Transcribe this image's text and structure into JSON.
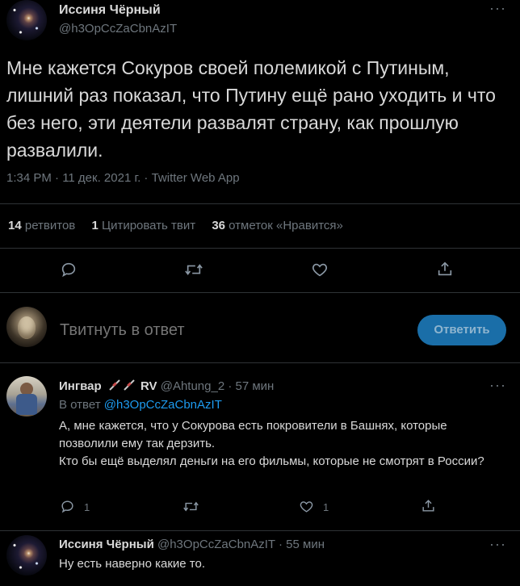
{
  "main_tweet": {
    "author_name": "Иссиня Чёрный",
    "author_handle": "@h3OpCcZaCbnAzIT",
    "text": "Мне кажется Сокуров своей полемикой с Путиным, лишний раз показал, что Путину ещё рано уходить и что без него, эти деятели развалят страну, как прошлую развалили.",
    "timestamp": "1:34 PM · 11 дек. 2021 г. · Twitter Web App",
    "stats": {
      "retweets_count": "14",
      "retweets_label": "ретвитов",
      "quotes_count": "1",
      "quotes_label": "Цитировать твит",
      "likes_count": "36",
      "likes_label": "отметок «Нравится»"
    }
  },
  "reply_box": {
    "placeholder": "Твитнуть в ответ",
    "button_label": "Ответить"
  },
  "replies": [
    {
      "author_name": "Ингвар",
      "author_suffix": "RV",
      "author_emoji": "syringe-icon",
      "author_handle": "@Ahtung_2",
      "time": "· 57 мин",
      "reply_to_label": "В ответ",
      "reply_to_handle": "@h3OpCcZaCbnAzIT",
      "text_line1": "А, мне кажется, что у Сокурова есть покровители в Башнях, которые позволили ему так дерзить.",
      "text_line2": "Кто бы ещё выделял деньги на его фильмы, которые не смотрят в России?",
      "reply_count": "1",
      "retweet_count": "",
      "like_count": "1"
    },
    {
      "author_name": "Иссиня Чёрный",
      "author_handle": "@h3OpCcZaCbnAzIT",
      "time": "· 55 мин",
      "text": "Ну есть наверно какие то."
    }
  ],
  "colors": {
    "background": "#000000",
    "text": "#d9d9d9",
    "muted": "#6e767d",
    "accent": "#1d9bf0",
    "button": "#1a6ea8",
    "divider": "#2f3336"
  }
}
